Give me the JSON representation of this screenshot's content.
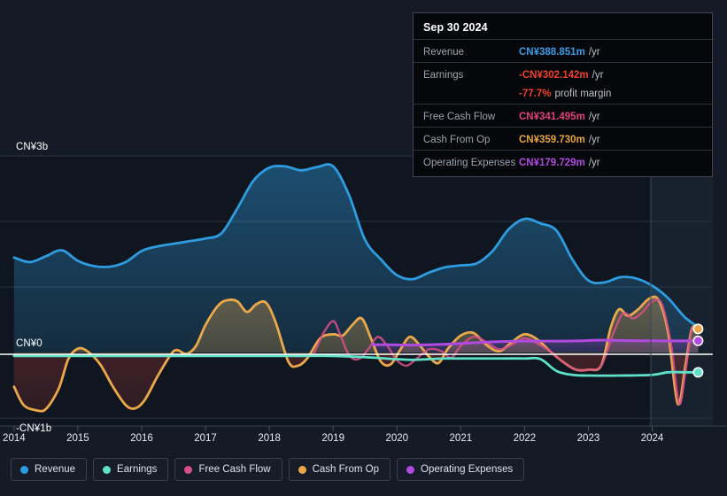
{
  "chart_data": {
    "type": "area",
    "title": "",
    "xlabel": "",
    "ylabel": "",
    "currency": "CN¥",
    "grid": true,
    "legend_position": "bottom",
    "x": [
      2014,
      2015,
      2016,
      2017,
      2018,
      2019,
      2020,
      2021,
      2022,
      2023,
      2024
    ],
    "xlim": [
      2013.8,
      2024.9
    ],
    "ylim": [
      -1.0,
      3.0
    ],
    "y_ticks": [
      {
        "value": 3.0,
        "label": "CN¥3b"
      },
      {
        "value": 2.0,
        "label": ""
      },
      {
        "value": 1.0,
        "label": ""
      },
      {
        "value": 0.0,
        "label": "CN¥0"
      },
      {
        "value": -1.0,
        "label": "-CN¥1b"
      }
    ],
    "x_tick_labels": [
      "2014",
      "2015",
      "2016",
      "2017",
      "2018",
      "2019",
      "2020",
      "2021",
      "2022",
      "2023",
      "2024"
    ],
    "units": "billions CN¥",
    "series": [
      {
        "name": "Revenue",
        "color": "#2e9ce0",
        "points": [
          [
            2014.0,
            1.45
          ],
          [
            2014.25,
            1.38
          ],
          [
            2014.5,
            1.47
          ],
          [
            2014.75,
            1.56
          ],
          [
            2015.0,
            1.4
          ],
          [
            2015.25,
            1.32
          ],
          [
            2015.5,
            1.31
          ],
          [
            2015.75,
            1.38
          ],
          [
            2016.0,
            1.55
          ],
          [
            2016.25,
            1.62
          ],
          [
            2016.5,
            1.66
          ],
          [
            2016.75,
            1.7
          ],
          [
            2017.0,
            1.74
          ],
          [
            2017.25,
            1.82
          ],
          [
            2017.5,
            2.2
          ],
          [
            2017.75,
            2.62
          ],
          [
            2018.0,
            2.82
          ],
          [
            2018.25,
            2.84
          ],
          [
            2018.5,
            2.78
          ],
          [
            2018.75,
            2.83
          ],
          [
            2019.0,
            2.84
          ],
          [
            2019.25,
            2.4
          ],
          [
            2019.5,
            1.72
          ],
          [
            2019.75,
            1.42
          ],
          [
            2020.0,
            1.18
          ],
          [
            2020.25,
            1.12
          ],
          [
            2020.5,
            1.22
          ],
          [
            2020.75,
            1.3
          ],
          [
            2021.0,
            1.33
          ],
          [
            2021.25,
            1.36
          ],
          [
            2021.5,
            1.55
          ],
          [
            2021.75,
            1.88
          ],
          [
            2022.0,
            2.04
          ],
          [
            2022.25,
            1.97
          ],
          [
            2022.5,
            1.86
          ],
          [
            2022.75,
            1.42
          ],
          [
            2023.0,
            1.1
          ],
          [
            2023.25,
            1.07
          ],
          [
            2023.5,
            1.15
          ],
          [
            2023.75,
            1.13
          ],
          [
            2024.0,
            1.02
          ],
          [
            2024.25,
            0.83
          ],
          [
            2024.5,
            0.55
          ],
          [
            2024.72,
            0.389
          ]
        ]
      },
      {
        "name": "Earnings",
        "color": "#5fe0c8",
        "points": [
          [
            2014.0,
            -0.05
          ],
          [
            2014.5,
            -0.05
          ],
          [
            2015.0,
            -0.05
          ],
          [
            2015.5,
            -0.05
          ],
          [
            2016.0,
            -0.05
          ],
          [
            2016.5,
            -0.05
          ],
          [
            2017.0,
            -0.05
          ],
          [
            2017.5,
            -0.05
          ],
          [
            2018.0,
            -0.05
          ],
          [
            2018.5,
            -0.05
          ],
          [
            2019.0,
            -0.05
          ],
          [
            2019.5,
            -0.07
          ],
          [
            2020.0,
            -0.1
          ],
          [
            2020.25,
            -0.11
          ],
          [
            2020.5,
            -0.1
          ],
          [
            2020.75,
            -0.09
          ],
          [
            2021.0,
            -0.09
          ],
          [
            2021.5,
            -0.09
          ],
          [
            2022.0,
            -0.09
          ],
          [
            2022.25,
            -0.1
          ],
          [
            2022.5,
            -0.28
          ],
          [
            2022.75,
            -0.34
          ],
          [
            2023.0,
            -0.35
          ],
          [
            2023.5,
            -0.35
          ],
          [
            2024.0,
            -0.34
          ],
          [
            2024.25,
            -0.3
          ],
          [
            2024.5,
            -0.3
          ],
          [
            2024.72,
            -0.302
          ]
        ]
      },
      {
        "name": "Free Cash Flow",
        "color": "#d94f87",
        "points": [
          [
            2018.7,
            -0.02
          ],
          [
            2018.85,
            0.3
          ],
          [
            2019.0,
            0.48
          ],
          [
            2019.1,
            0.3
          ],
          [
            2019.25,
            -0.04
          ],
          [
            2019.4,
            -0.1
          ],
          [
            2019.55,
            0.05
          ],
          [
            2019.7,
            0.24
          ],
          [
            2019.85,
            0.1
          ],
          [
            2020.0,
            -0.12
          ],
          [
            2020.15,
            -0.2
          ],
          [
            2020.3,
            -0.1
          ],
          [
            2020.5,
            0.05
          ],
          [
            2020.7,
            0.02
          ],
          [
            2020.85,
            -0.08
          ],
          [
            2021.0,
            0.1
          ],
          [
            2021.2,
            0.24
          ],
          [
            2021.4,
            0.16
          ],
          [
            2021.6,
            0.05
          ],
          [
            2021.8,
            0.12
          ],
          [
            2022.0,
            0.22
          ],
          [
            2022.2,
            0.14
          ],
          [
            2022.4,
            0.02
          ],
          [
            2022.6,
            -0.14
          ],
          [
            2022.8,
            -0.26
          ],
          [
            2023.0,
            -0.26
          ],
          [
            2023.2,
            -0.2
          ],
          [
            2023.4,
            0.32
          ],
          [
            2023.55,
            0.6
          ],
          [
            2023.7,
            0.52
          ],
          [
            2023.85,
            0.62
          ],
          [
            2024.0,
            0.78
          ],
          [
            2024.15,
            0.74
          ],
          [
            2024.3,
            0.1
          ],
          [
            2024.42,
            -0.78
          ],
          [
            2024.52,
            -0.3
          ],
          [
            2024.62,
            0.34
          ],
          [
            2024.72,
            0.341
          ]
        ]
      },
      {
        "name": "Cash From Op",
        "color": "#eaa84a",
        "points": [
          [
            2014.0,
            -0.52
          ],
          [
            2014.15,
            -0.8
          ],
          [
            2014.35,
            -0.88
          ],
          [
            2014.5,
            -0.86
          ],
          [
            2014.7,
            -0.55
          ],
          [
            2014.85,
            -0.1
          ],
          [
            2015.0,
            0.06
          ],
          [
            2015.15,
            0.02
          ],
          [
            2015.35,
            -0.18
          ],
          [
            2015.55,
            -0.52
          ],
          [
            2015.75,
            -0.8
          ],
          [
            2015.9,
            -0.85
          ],
          [
            2016.05,
            -0.72
          ],
          [
            2016.25,
            -0.36
          ],
          [
            2016.45,
            -0.04
          ],
          [
            2016.55,
            0.04
          ],
          [
            2016.7,
            -0.02
          ],
          [
            2016.85,
            0.1
          ],
          [
            2017.0,
            0.42
          ],
          [
            2017.2,
            0.72
          ],
          [
            2017.35,
            0.8
          ],
          [
            2017.5,
            0.78
          ],
          [
            2017.65,
            0.62
          ],
          [
            2017.8,
            0.74
          ],
          [
            2017.95,
            0.76
          ],
          [
            2018.1,
            0.46
          ],
          [
            2018.3,
            -0.14
          ],
          [
            2018.45,
            -0.2
          ],
          [
            2018.6,
            -0.08
          ],
          [
            2018.8,
            0.22
          ],
          [
            2019.0,
            0.28
          ],
          [
            2019.15,
            0.26
          ],
          [
            2019.3,
            0.42
          ],
          [
            2019.45,
            0.52
          ],
          [
            2019.6,
            0.2
          ],
          [
            2019.75,
            -0.14
          ],
          [
            2019.9,
            -0.18
          ],
          [
            2020.05,
            0.04
          ],
          [
            2020.2,
            0.24
          ],
          [
            2020.35,
            0.12
          ],
          [
            2020.5,
            -0.06
          ],
          [
            2020.65,
            -0.16
          ],
          [
            2020.8,
            0.06
          ],
          [
            2021.0,
            0.26
          ],
          [
            2021.2,
            0.3
          ],
          [
            2021.4,
            0.12
          ],
          [
            2021.6,
            0.02
          ],
          [
            2021.8,
            0.16
          ],
          [
            2022.0,
            0.28
          ],
          [
            2022.2,
            0.2
          ],
          [
            2022.4,
            0.02
          ],
          [
            2022.6,
            -0.14
          ],
          [
            2022.8,
            -0.26
          ],
          [
            2023.0,
            -0.26
          ],
          [
            2023.2,
            -0.2
          ],
          [
            2023.35,
            0.38
          ],
          [
            2023.48,
            0.66
          ],
          [
            2023.62,
            0.56
          ],
          [
            2023.78,
            0.66
          ],
          [
            2023.95,
            0.82
          ],
          [
            2024.1,
            0.8
          ],
          [
            2024.25,
            0.3
          ],
          [
            2024.4,
            -0.78
          ],
          [
            2024.52,
            -0.2
          ],
          [
            2024.62,
            0.36
          ],
          [
            2024.72,
            0.36
          ]
        ]
      },
      {
        "name": "Operating Expenses",
        "color": "#b14ae0",
        "points": [
          [
            2019.62,
            0.12
          ],
          [
            2019.9,
            0.12
          ],
          [
            2020.2,
            0.115
          ],
          [
            2020.5,
            0.12
          ],
          [
            2020.8,
            0.13
          ],
          [
            2021.1,
            0.145
          ],
          [
            2021.4,
            0.16
          ],
          [
            2021.7,
            0.17
          ],
          [
            2022.0,
            0.175
          ],
          [
            2022.3,
            0.175
          ],
          [
            2022.6,
            0.175
          ],
          [
            2022.9,
            0.18
          ],
          [
            2023.2,
            0.19
          ],
          [
            2023.5,
            0.185
          ],
          [
            2023.8,
            0.18
          ],
          [
            2024.1,
            0.18
          ],
          [
            2024.4,
            0.178
          ],
          [
            2024.72,
            0.1797
          ]
        ]
      }
    ],
    "end_markers": [
      {
        "series": "Cash From Op",
        "value": 0.36,
        "color": "#eaa84a"
      },
      {
        "series": "Operating Expenses",
        "value": 0.1797,
        "color": "#b14ae0"
      },
      {
        "series": "Earnings",
        "value": -0.302,
        "color": "#5fe0c8"
      }
    ],
    "hover_date": "Sep 30 2024"
  },
  "tooltip": {
    "title": "Sep 30 2024",
    "rows": [
      {
        "label": "Revenue",
        "value": "CN¥388.851m",
        "unit": "/yr",
        "color": "#3a9ce8"
      },
      {
        "label": "Earnings",
        "value": "-CN¥302.142m",
        "unit": "/yr",
        "color": "#f0402c"
      },
      {
        "label": "",
        "value": "-77.7%",
        "unit": "profit margin",
        "color": "#f0402c"
      },
      {
        "label": "Free Cash Flow",
        "value": "CN¥341.495m",
        "unit": "/yr",
        "color": "#e33f78"
      },
      {
        "label": "Cash From Op",
        "value": "CN¥359.730m",
        "unit": "/yr",
        "color": "#e8a33c"
      },
      {
        "label": "Operating Expenses",
        "value": "CN¥179.729m",
        "unit": "/yr",
        "color": "#b14ae0"
      }
    ]
  },
  "legend": {
    "items": [
      {
        "label": "Revenue",
        "color": "#2e9ce0"
      },
      {
        "label": "Earnings",
        "color": "#5fe0c8"
      },
      {
        "label": "Free Cash Flow",
        "color": "#d94f87"
      },
      {
        "label": "Cash From Op",
        "color": "#eaa84a"
      },
      {
        "label": "Operating Expenses",
        "color": "#b14ae0"
      }
    ]
  },
  "axis": {
    "y_labels": [
      {
        "text": "CN¥3b",
        "value": 3.0
      },
      {
        "text": "CN¥0",
        "value": 0.0
      },
      {
        "text": "-CN¥1b",
        "value": -1.0
      }
    ],
    "x_labels": [
      "2014",
      "2015",
      "2016",
      "2017",
      "2018",
      "2019",
      "2020",
      "2021",
      "2022",
      "2023",
      "2024"
    ]
  }
}
